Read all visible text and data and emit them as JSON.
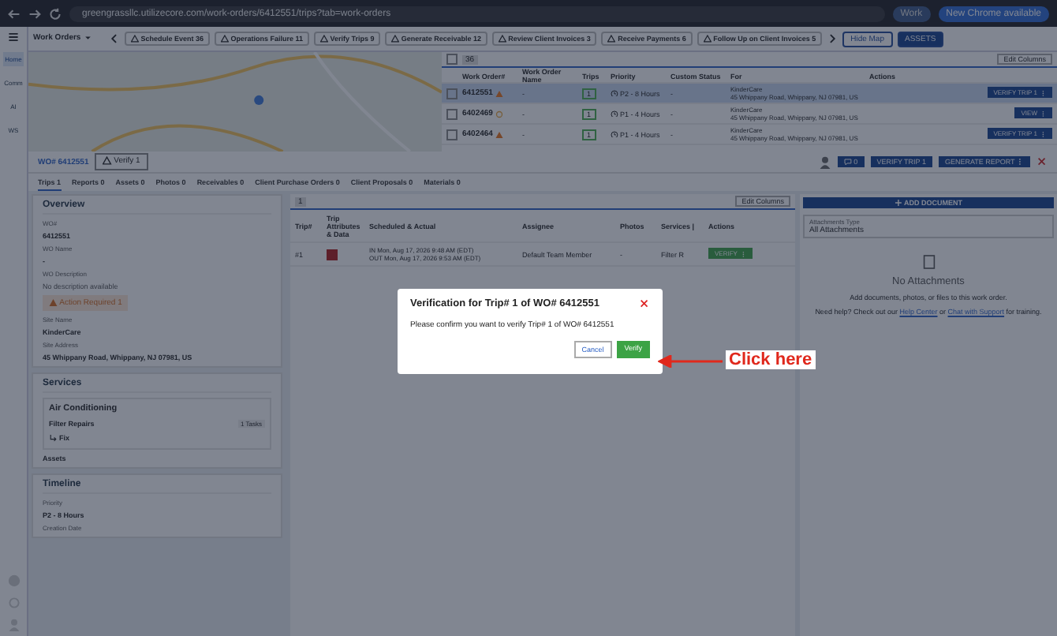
{
  "browser": {
    "url": "greengrassllc.utilizecore.com/work-orders/6412551/trips?tab=work-orders",
    "profile": "Work",
    "update": "New Chrome available"
  },
  "rail": [
    {
      "label": "Home",
      "selected": true
    },
    {
      "label": "Comm",
      "selected": false
    },
    {
      "label": "AI",
      "selected": false
    },
    {
      "label": "WS",
      "selected": false
    }
  ],
  "module": "Work Orders",
  "chips": [
    {
      "label": "Schedule Event",
      "count": "36"
    },
    {
      "label": "Operations Failure",
      "count": "11"
    },
    {
      "label": "Verify Trips",
      "count": "9"
    },
    {
      "label": "Generate Receivable",
      "count": "12"
    },
    {
      "label": "Review Client Invoices",
      "count": "3"
    },
    {
      "label": "Receive Payments",
      "count": "6"
    },
    {
      "label": "Follow Up on Client Invoices",
      "count": "5"
    }
  ],
  "hide_map": "Hide Map",
  "assets_button": "ASSETS",
  "list": {
    "count": "36",
    "edit_columns": "Edit Columns",
    "columns": [
      "Work Order#",
      "Work Order Name",
      "Trips",
      "Priority",
      "Custom Status",
      "For",
      "Actions"
    ],
    "rows": [
      {
        "wo": "6412551",
        "kind": "warning",
        "name": "-",
        "trips": "1",
        "priority": "P2 - 8 Hours",
        "custom_status": "-",
        "client": "KinderCare",
        "address": "45 Whippany Road, Whippany, NJ 07981, US",
        "action": "VERIFY TRIP 1",
        "selected": true
      },
      {
        "wo": "6402469",
        "kind": "pending",
        "name": "-",
        "trips": "1",
        "priority": "P1 - 4 Hours",
        "custom_status": "-",
        "client": "KinderCare",
        "address": "45 Whippany Road, Whippany, NJ 07981, US",
        "action": "VIEW",
        "selected": false
      },
      {
        "wo": "6402464",
        "kind": "warning",
        "name": "-",
        "trips": "1",
        "priority": "P1 - 4 Hours",
        "custom_status": "-",
        "client": "KinderCare",
        "address": "45 Whippany Road, Whippany, NJ 07981, US",
        "action": "VERIFY TRIP 1",
        "selected": false
      }
    ]
  },
  "detail": {
    "wo": "WO# 6412551",
    "verify": {
      "label": "Verify",
      "count": "1"
    },
    "chat_count": "0",
    "verify_trip": "VERIFY TRIP 1",
    "report": "GENERATE REPORT"
  },
  "tabs": [
    {
      "label": "Trips",
      "count": "1",
      "selected": true
    },
    {
      "label": "Reports",
      "count": "0",
      "selected": false
    },
    {
      "label": "Assets",
      "count": "0",
      "selected": false
    },
    {
      "label": "Photos",
      "count": "0",
      "selected": false
    },
    {
      "label": "Receivables",
      "count": "0",
      "selected": false
    },
    {
      "label": "Client Purchase Orders",
      "count": "0",
      "selected": false
    },
    {
      "label": "Client Proposals",
      "count": "0",
      "selected": false
    },
    {
      "label": "Materials",
      "count": "0",
      "selected": false
    }
  ],
  "overview": {
    "title": "Overview",
    "fields": [
      {
        "label": "WO#",
        "value": "6412551",
        "kind": "copy"
      },
      {
        "label": "WO Name",
        "value": "-",
        "kind": "text"
      },
      {
        "label": "WO Description",
        "value": "No description available",
        "kind": "muted"
      },
      {
        "label": "Action Required",
        "value": "1",
        "kind": "alert"
      },
      {
        "label": "Site Name",
        "value": "KinderCare",
        "kind": "text"
      },
      {
        "label": "Site Address",
        "value": "45 Whippany Road, Whippany, NJ 07981, US",
        "kind": "text"
      }
    ]
  },
  "services": {
    "title": "Services",
    "category": "Air Conditioning",
    "service": "Filter Repairs",
    "tasks": "1 Tasks",
    "task": "Fix",
    "assets": "Assets"
  },
  "timeline": {
    "title": "Timeline",
    "priority_label": "Priority",
    "priority": "P2 - 8 Hours",
    "creation_label": "Creation Date"
  },
  "trips": {
    "count": "1",
    "edit_columns": "Edit Columns",
    "columns": [
      "Trip#",
      "Trip Attributes & Data",
      "Scheduled & Actual",
      "Assignee",
      "Photos",
      "Services |",
      "Actions"
    ],
    "rows": [
      {
        "trip": "#1",
        "check_in": "IN Mon, Aug 17, 2026 9:48 AM (EDT)",
        "check_out": "OUT Mon, Aug 17, 2026 9:53 AM (EDT)",
        "assignee": "Default Team Member",
        "photos": "-",
        "services": "Filter R",
        "action": "VERIFY"
      }
    ]
  },
  "attachments": {
    "add": "ADD DOCUMENT",
    "type_label": "Attachments Type",
    "type_value": "All Attachments",
    "empty_title": "No Attachments",
    "empty_text": "Add documents, photos, or files to this work order.",
    "help_before": "Need help? Check out our",
    "help_link": "Help Center",
    "help_mid": "or",
    "support_link": "Chat with Support",
    "help_after": "for training."
  },
  "dialog": {
    "title": "Verification for Trip# 1 of WO# 6412551",
    "body": "Please confirm you want to verify Trip# 1 of WO# 6412551",
    "cancel": "Cancel",
    "confirm": "Verify"
  },
  "annotation": "Click here"
}
